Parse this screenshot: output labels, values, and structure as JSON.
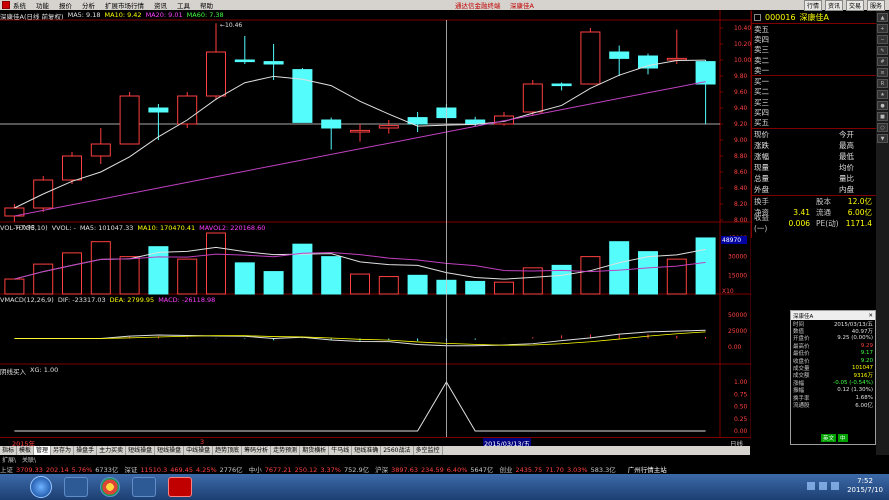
{
  "menubar": {
    "items": [
      "系统",
      "功能",
      "报价",
      "分析",
      "扩展市场行情",
      "资讯",
      "工具",
      "帮助"
    ],
    "center_title": "通达信金融终端",
    "center_stock": "深康佳A",
    "right_tools": [
      "行情",
      "资讯",
      "交易",
      "服务"
    ]
  },
  "chart_header": {
    "name": "深康佳A(日线 前复权)",
    "ma5_label": "MA5: 9.18",
    "ma10_label": "MA10: 9.42",
    "ma20_label": "MA20: 9.01",
    "ma60_label": "MA60: 7.38"
  },
  "price_panel": {
    "high_label": "10.46",
    "low_label": "7.98",
    "y_ticks": [
      "10.40",
      "10.20",
      "10.00",
      "9.80",
      "9.60",
      "9.40",
      "9.20",
      "9.00",
      "8.80",
      "8.60",
      "8.40",
      "8.20",
      "8.00"
    ]
  },
  "vol_panel": {
    "title": "VOL-TDX(5,10)",
    "vol_label": "VVOL: -",
    "ma5_label": "MA5: 101047.33",
    "ma10_label": "MA10: 170470.41",
    "mavol2_label": "MAVOL2: 220168.60",
    "y_ticks": [
      "45000",
      "30000",
      "15000"
    ],
    "top_label": "48970",
    "unit_label": "X10"
  },
  "macd_panel": {
    "title": "VMACD(12,26,9)",
    "dif_label": "DIF: -23317.03",
    "dea_label": "DEA: 2799.95",
    "macd_label": "MACD: -26118.98",
    "y_ticks": [
      "50000",
      "25000",
      "0.00"
    ]
  },
  "signal_panel": {
    "title": "阴线买入",
    "xg_label": "XG: 1.00",
    "y_ticks": [
      "1.00",
      "0.75",
      "0.50",
      "0.25",
      "0.00"
    ]
  },
  "date_axis": {
    "start": "2015年",
    "mid": "3",
    "cursor": "2015/03/13/五",
    "period": "日线"
  },
  "quote": {
    "code": "000016",
    "name": "深康佳A",
    "sell_levels": [
      "卖五",
      "卖四",
      "卖三",
      "卖二",
      "卖一"
    ],
    "buy_levels": [
      "买一",
      "买二",
      "买三",
      "买四",
      "买五"
    ],
    "stats_left": [
      "现价",
      "涨跌",
      "涨幅",
      "现量",
      "总量",
      "外盘"
    ],
    "stats_right": [
      "今开",
      "最高",
      "最低",
      "均价",
      "量比",
      "内盘"
    ],
    "bottom": [
      {
        "l1": "换手",
        "v1": "",
        "l2": "股本",
        "v2": "12.0亿"
      },
      {
        "l1": "净资",
        "v1": "3.41",
        "l2": "流通",
        "v2": "6.00亿"
      },
      {
        "l1": "收益(一)",
        "v1": "0.006",
        "l2": "PE(动)",
        "v2": "1171.4"
      }
    ]
  },
  "info_window": {
    "title": "深康佳A",
    "rows": [
      {
        "k": "时间",
        "v": "2015/03/13/五",
        "color": "#e0e0e0"
      },
      {
        "k": "数值",
        "v": "40.97万",
        "color": "#e0e0e0"
      },
      {
        "k": "开盘价",
        "v": "9.25 (0.00%)",
        "color": "#e0e0e0"
      },
      {
        "k": "最高价",
        "v": "9.29",
        "color": "#ff4040"
      },
      {
        "k": "最低价",
        "v": "9.17",
        "color": "#40ff40"
      },
      {
        "k": "收盘价",
        "v": "9.20",
        "color": "#40ff40"
      },
      {
        "k": "成交量",
        "v": "101047",
        "color": "#ffff00"
      },
      {
        "k": "成交额",
        "v": "9316万",
        "color": "#ffff00"
      },
      {
        "k": "涨幅",
        "v": "-0.05 (-0.54%)",
        "color": "#40ff40"
      },
      {
        "k": "振幅",
        "v": "0.12 (1.30%)",
        "color": "#e0e0e0"
      },
      {
        "k": "换手率",
        "v": "1.68%",
        "color": "#e0e0e0"
      },
      {
        "k": "流通股",
        "v": "6.00亿",
        "color": "#e0e0e0"
      }
    ],
    "buttons": [
      "英文",
      "中"
    ]
  },
  "tabs": [
    "指标",
    "模板",
    "管理",
    "另存为",
    "操盘手",
    "主力买卖",
    "短线操盘",
    "短线操盘",
    "中线操盘",
    "趋势顶底",
    "筹码分析",
    "走势预测",
    "期货横析",
    "牛马线",
    "短线准确",
    "2560战法",
    "多空监控"
  ],
  "active_tab_index": 2,
  "subtabs": [
    "扩展\\",
    "关联\\"
  ],
  "ticker": [
    {
      "name": "上证",
      "val": "3709.33",
      "chg": "202.14",
      "pct": "5.76%",
      "amt": "6733亿"
    },
    {
      "name": "深证",
      "val": "11510.3",
      "chg": "469.45",
      "pct": "4.25%",
      "amt": "2776亿"
    },
    {
      "name": "中小",
      "val": "7677.21",
      "chg": "250.12",
      "pct": "3.37%",
      "amt": "752.9亿"
    },
    {
      "name": "沪深",
      "val": "3897.63",
      "chg": "234.59",
      "pct": "6.40%",
      "amt": "5647亿"
    },
    {
      "name": "创业",
      "val": "2435.75",
      "chg": "71.70",
      "pct": "3.03%",
      "amt": "583.3亿"
    }
  ],
  "ticker_msg": "广州行情主站",
  "clock": {
    "time": "7:52",
    "date": "2015/7/10"
  },
  "colors": {
    "up": "#ff4040",
    "down_fill": "#54fcfc",
    "frame": "#800000",
    "ma_white": "#e0e0e0",
    "ma_magenta": "#c040c0"
  },
  "chart_data": {
    "type": "candlestick",
    "series": [
      {
        "o": 8.05,
        "h": 8.2,
        "l": 7.98,
        "c": 8.15,
        "up": true,
        "vol": 12000
      },
      {
        "o": 8.15,
        "h": 8.55,
        "l": 8.1,
        "c": 8.5,
        "up": true,
        "vol": 24000
      },
      {
        "o": 8.5,
        "h": 8.85,
        "l": 8.45,
        "c": 8.8,
        "up": true,
        "vol": 33000
      },
      {
        "o": 8.8,
        "h": 9.15,
        "l": 8.7,
        "c": 8.95,
        "up": true,
        "vol": 42000
      },
      {
        "o": 8.95,
        "h": 9.6,
        "l": 8.95,
        "c": 9.55,
        "up": true,
        "vol": 30000
      },
      {
        "o": 9.35,
        "h": 9.45,
        "l": 9.0,
        "c": 9.4,
        "up": false,
        "vol": 38000
      },
      {
        "o": 9.2,
        "h": 9.6,
        "l": 9.15,
        "c": 9.55,
        "up": true,
        "vol": 28000
      },
      {
        "o": 9.55,
        "h": 10.46,
        "l": 9.5,
        "c": 10.1,
        "up": true,
        "vol": 48970
      },
      {
        "o": 10.0,
        "h": 10.3,
        "l": 9.95,
        "c": 9.98,
        "up": false,
        "vol": 25000
      },
      {
        "o": 9.98,
        "h": 10.2,
        "l": 9.75,
        "c": 9.95,
        "up": false,
        "vol": 18000
      },
      {
        "o": 9.88,
        "h": 9.9,
        "l": 9.22,
        "c": 9.22,
        "up": false,
        "vol": 40000
      },
      {
        "o": 9.25,
        "h": 9.28,
        "l": 8.88,
        "c": 9.15,
        "up": false,
        "vol": 30000
      },
      {
        "o": 9.1,
        "h": 9.2,
        "l": 8.98,
        "c": 9.12,
        "up": true,
        "vol": 16000
      },
      {
        "o": 9.15,
        "h": 9.25,
        "l": 9.08,
        "c": 9.18,
        "up": true,
        "vol": 14000
      },
      {
        "o": 9.28,
        "h": 9.35,
        "l": 9.1,
        "c": 9.2,
        "up": false,
        "vol": 15000
      },
      {
        "o": 9.4,
        "h": 9.45,
        "l": 9.22,
        "c": 9.28,
        "up": false,
        "vol": 11000
      },
      {
        "o": 9.25,
        "h": 9.29,
        "l": 9.17,
        "c": 9.2,
        "up": false,
        "vol": 10100
      },
      {
        "o": 9.2,
        "h": 9.35,
        "l": 9.18,
        "c": 9.3,
        "up": true,
        "vol": 9500
      },
      {
        "o": 9.35,
        "h": 9.75,
        "l": 9.3,
        "c": 9.7,
        "up": true,
        "vol": 21000
      },
      {
        "o": 9.7,
        "h": 9.72,
        "l": 9.62,
        "c": 9.68,
        "up": false,
        "vol": 23000
      },
      {
        "o": 9.7,
        "h": 10.4,
        "l": 9.7,
        "c": 10.35,
        "up": true,
        "vol": 30000
      },
      {
        "o": 10.1,
        "h": 10.18,
        "l": 9.8,
        "c": 10.02,
        "up": false,
        "vol": 42000
      },
      {
        "o": 10.05,
        "h": 10.08,
        "l": 9.82,
        "c": 9.9,
        "up": false,
        "vol": 34000
      },
      {
        "o": 10.0,
        "h": 10.38,
        "l": 9.95,
        "c": 10.02,
        "up": true,
        "vol": 28000
      },
      {
        "o": 9.98,
        "h": 10.0,
        "l": 9.2,
        "c": 9.7,
        "up": false,
        "vol": 45000
      }
    ],
    "price_ylim": [
      8.0,
      10.4
    ],
    "vol_ylim": [
      0,
      48970
    ],
    "signal_index": 15
  }
}
